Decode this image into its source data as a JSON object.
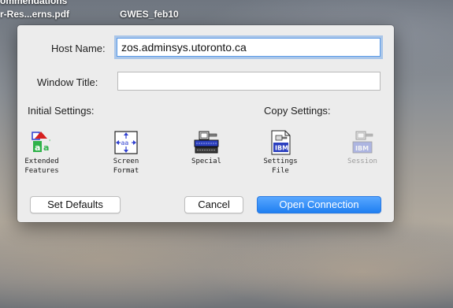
{
  "desktop": {
    "files": [
      {
        "line1": "ommendations",
        "line2": "r-Res...erns.pdf"
      },
      {
        "line1": "",
        "line2": "GWES_feb10"
      }
    ]
  },
  "dialog": {
    "host_label": "Host Name:",
    "host_value": "zos.adminsys.utoronto.ca",
    "window_title_label": "Window Title:",
    "window_title_value": "",
    "initial_settings_label": "Initial Settings:",
    "copy_settings_label": "Copy Settings:",
    "tools": [
      {
        "line1": "Extended",
        "line2": "Features",
        "icon": "extended-features-icon",
        "enabled": true
      },
      {
        "line1": "Screen",
        "line2": "Format",
        "icon": "screen-format-icon",
        "enabled": true
      },
      {
        "line1": "Special",
        "line2": "",
        "icon": "special-icon",
        "enabled": true
      },
      {
        "line1": "Settings",
        "line2": "File",
        "icon": "settings-file-icon",
        "enabled": true
      },
      {
        "line1": "Session",
        "line2": "",
        "icon": "session-icon",
        "enabled": false
      }
    ],
    "buttons": {
      "set_defaults": "Set Defaults",
      "cancel": "Cancel",
      "open_connection": "Open Connection"
    },
    "colors": {
      "accent": "#1f7ff1",
      "focus_ring": "#5b9ae6"
    }
  }
}
